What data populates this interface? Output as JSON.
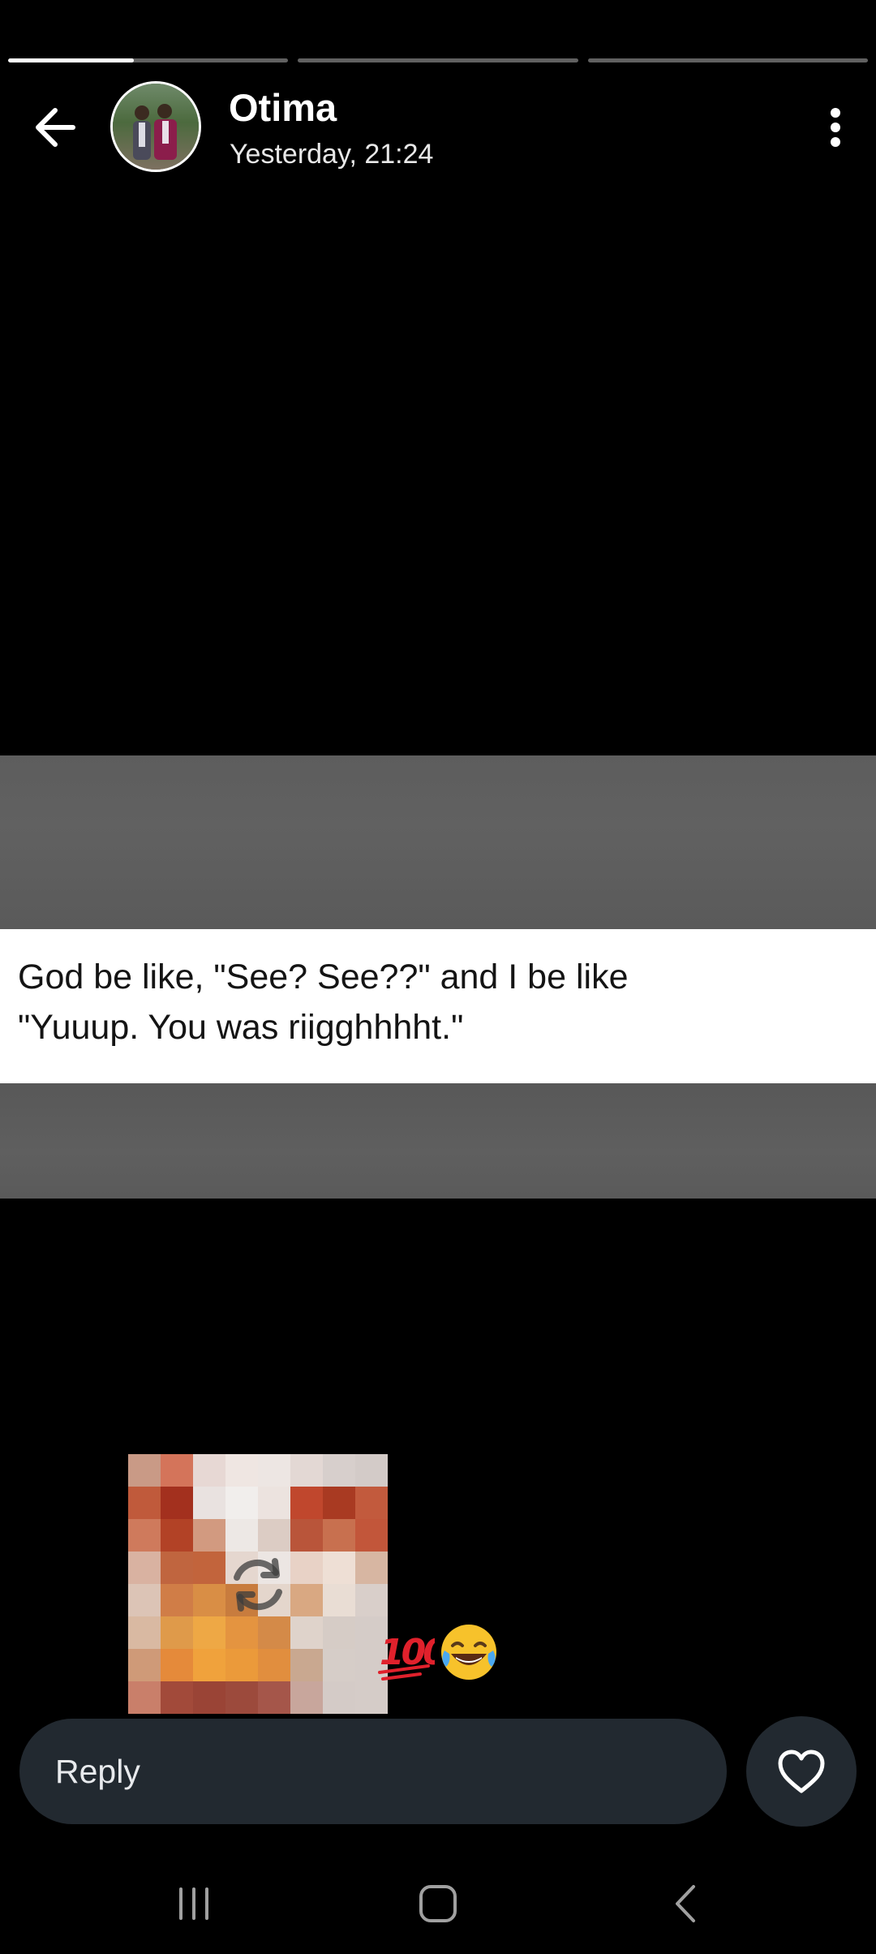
{
  "status": {
    "segments": [
      {
        "fill": 0.45
      },
      {
        "fill": 0
      },
      {
        "fill": 0
      }
    ]
  },
  "header": {
    "contact_name": "Otima",
    "timestamp": "Yesterday, 21:24",
    "back_icon": "arrow-left-icon",
    "menu_icon": "more-vertical-icon"
  },
  "post": {
    "tweet_lines": [
      "God be like, \"See? See??\" and I be like",
      "\"Yuuup. You was riigghhhht.\""
    ],
    "reactions": [
      "💯",
      "😂"
    ]
  },
  "reply": {
    "placeholder": "Reply",
    "like_icon": "heart-icon"
  },
  "system_nav": {
    "icons": [
      "recents-icon",
      "home-icon",
      "back-icon"
    ]
  },
  "colors": {
    "background": "#000000",
    "reply_bar": "#222930",
    "text_primary": "#ffffff",
    "progress_active": "#ffffff",
    "progress_inactive": "#5e5e5e"
  }
}
